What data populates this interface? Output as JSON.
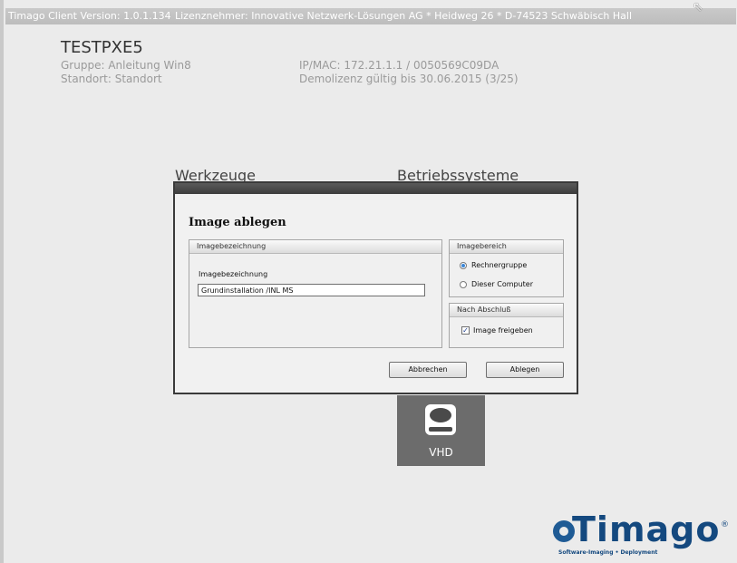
{
  "titlebar": {
    "version": "Timago Client Version: 1.0.1.134",
    "license": "Lizenznehmer: Innovative Netzwerk-Lösungen AG * Heidweg 26 * D-74523 Schwäbisch Hall"
  },
  "client": {
    "hostname": "TESTPXE5",
    "group": "Gruppe: Anleitung Win8",
    "location": "Standort: Standort",
    "ipmac": "IP/MAC: 172.21.1.1 / 0050569C09DA",
    "license_note": "Demolizenz gültig bis 30.06.2015 (3/25)"
  },
  "sections": {
    "tools": "Werkzeuge",
    "os": "Betriebssysteme"
  },
  "tile": {
    "label": "VHD",
    "icon": "hard-drive-icon"
  },
  "dialog": {
    "heading": "Image ablegen",
    "name_group": {
      "header": "Imagebezeichnung",
      "field_label": "Imagebezeichnung",
      "field_value": "Grundinstallation /INL MS"
    },
    "scope_group": {
      "header": "Imagebereich",
      "options": [
        "Rechnergruppe",
        "Dieser Computer"
      ],
      "selected": "Rechnergruppe"
    },
    "after_group": {
      "header": "Nach Abschluß",
      "checkbox_label": "Image freigeben",
      "checked": true
    },
    "cancel_label": "Abbrechen",
    "ok_label": "Ablegen"
  },
  "logo": {
    "text": "Timago",
    "tagline": "Software-Imaging • Deployment",
    "reg": "®",
    "color": "#14497f"
  }
}
